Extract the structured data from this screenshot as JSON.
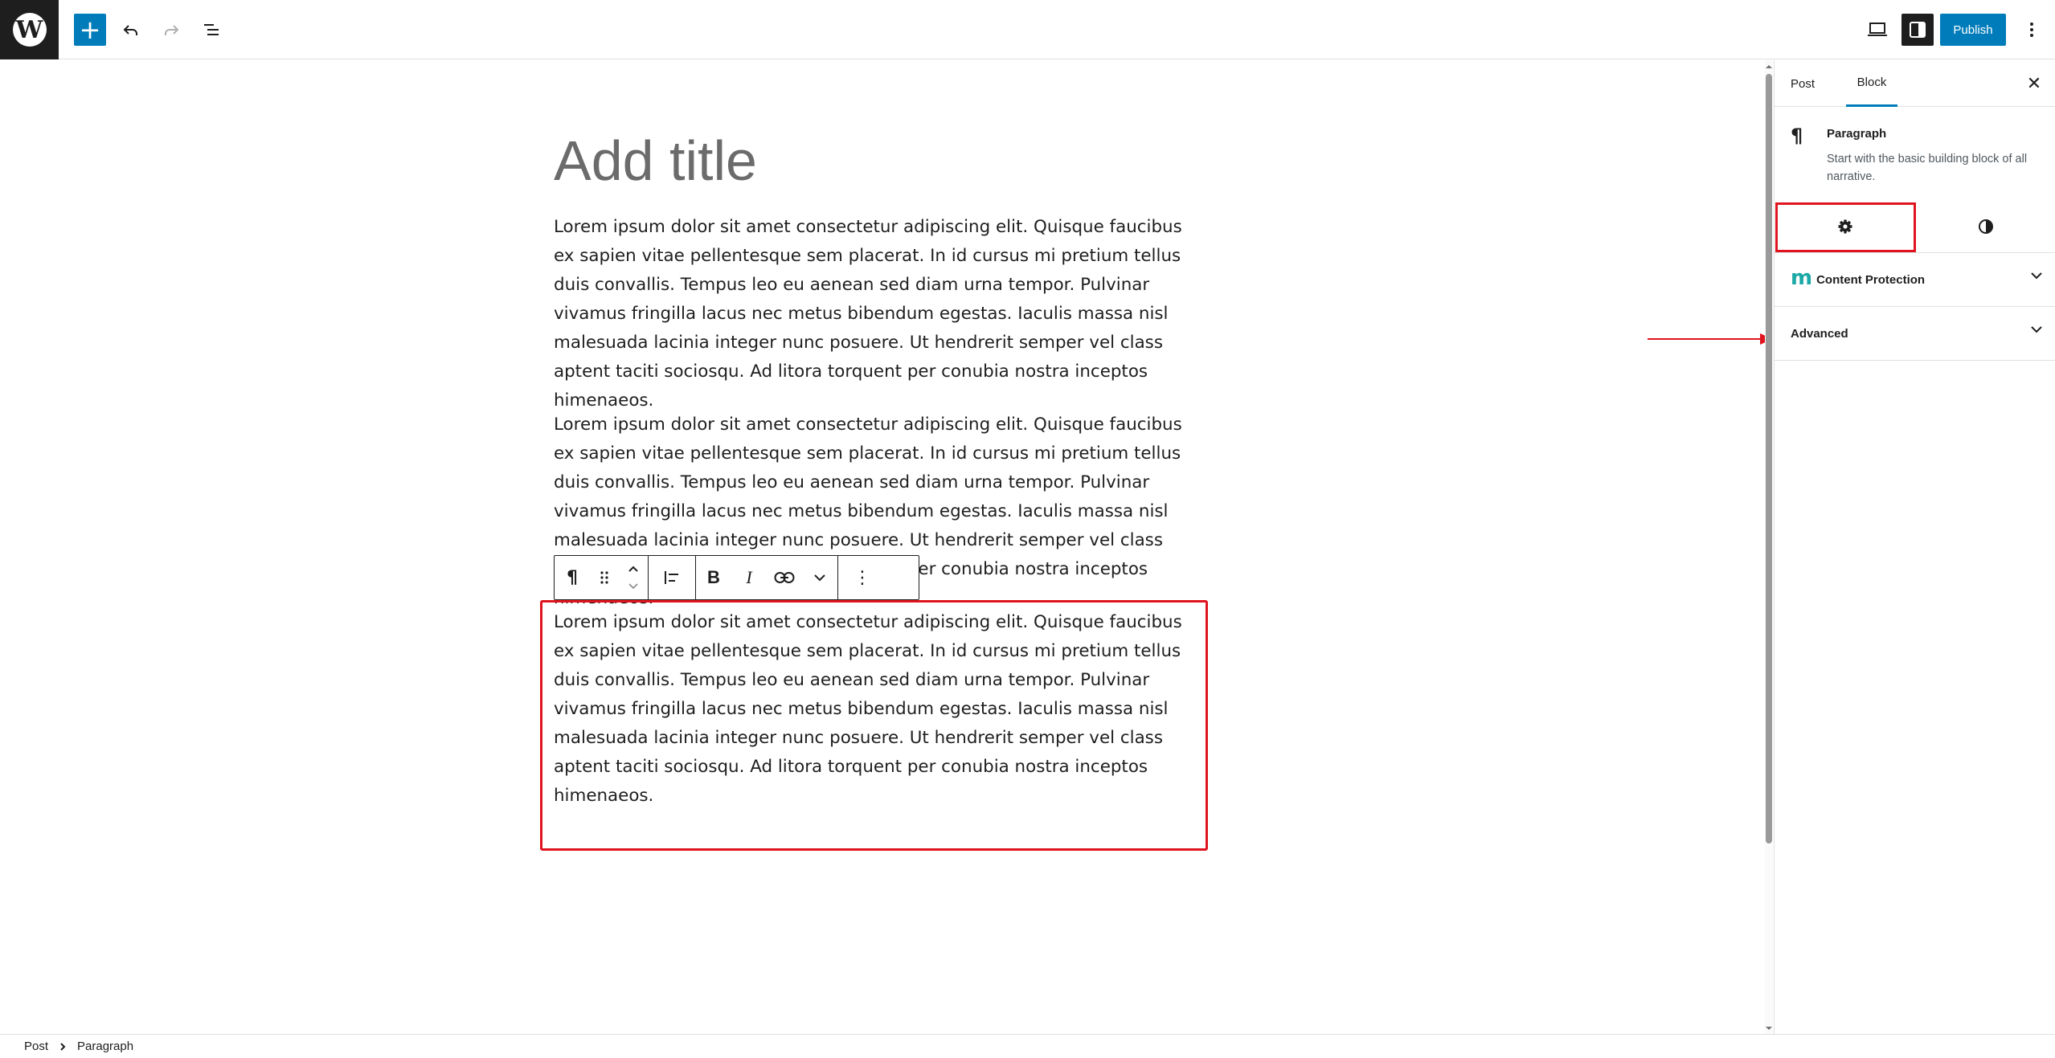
{
  "topbar": {
    "logo_glyph": "W",
    "add_glyph": "+",
    "publish_label": "Publish"
  },
  "editor": {
    "title_placeholder": "Add title",
    "paragraphs": [
      "Lorem ipsum dolor sit amet consectetur adipiscing elit. Quisque faucibus ex sapien vitae pellentesque sem placerat. In id cursus mi pretium tellus duis convallis. Tempus leo eu aenean sed diam urna tempor. Pulvinar vivamus fringilla lacus nec metus bibendum egestas. Iaculis massa nisl malesuada lacinia integer nunc posuere. Ut hendrerit semper vel class aptent taciti sociosqu. Ad litora torquent per conubia nostra inceptos himenaeos.",
      "Lorem ipsum dolor sit amet consectetur adipiscing elit. Quisque faucibus ex sapien vitae pellentesque sem placerat. In id cursus mi pretium tellus duis convallis. Tempus leo eu aenean sed diam urna tempor. Pulvinar vivamus fringilla lacus nec metus bibendum egestas. Iaculis massa nisl malesuada lacinia integer nunc posuere. Ut hendrerit semper vel class aptent taciti sociosqu. Ad litora torquent per conubia nostra inceptos himenaeos.",
      "Lorem ipsum dolor sit amet consectetur adipiscing elit. Quisque faucibus ex sapien vitae pellentesque sem placerat. In id cursus mi pretium tellus duis convallis. Tempus leo eu aenean sed diam urna tempor. Pulvinar vivamus fringilla lacus nec metus bibendum egestas. Iaculis massa nisl malesuada lacinia integer nunc posuere. Ut hendrerit semper vel class aptent taciti sociosqu. Ad litora torquent per conubia nostra inceptos himenaeos."
    ],
    "toolbar": {
      "paragraph_glyph": "¶",
      "bold_glyph": "B",
      "italic_glyph": "I",
      "more_glyph": "⋮"
    }
  },
  "sidebar": {
    "tabs": {
      "post": "Post",
      "block": "Block"
    },
    "close_glyph": "✕",
    "block_card": {
      "icon_glyph": "¶",
      "title": "Paragraph",
      "description": "Start with the basic building block of all narrative."
    },
    "panels": {
      "content_protection": {
        "logo_text": "m",
        "label": "Content Protection"
      },
      "advanced": {
        "label": "Advanced"
      }
    }
  },
  "footer": {
    "breadcrumbs": [
      "Post",
      "Paragraph"
    ]
  },
  "colors": {
    "accent": "#007cba",
    "highlight": "#e0141e",
    "dark": "#1e1e1e",
    "logo_teal": "#1ba8a6"
  },
  "icons": {
    "add": "plus-icon",
    "undo": "undo-icon",
    "redo": "redo-icon",
    "list_view": "list-view-icon",
    "view": "laptop-icon",
    "settings_toggle": "sidebar-toggle-icon",
    "options": "vertical-ellipsis-icon",
    "block_settings": "gear-icon",
    "block_styles": "half-circle-icon"
  }
}
